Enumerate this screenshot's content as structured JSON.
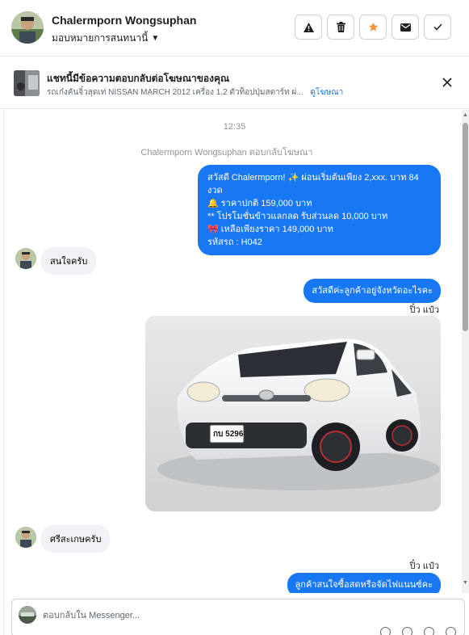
{
  "header": {
    "name": "Chalermporn Wongsuphan",
    "assign_label": "มอบหมายการสนทนานี้",
    "caret": "▼",
    "actions": [
      {
        "icon": "warning-icon"
      },
      {
        "icon": "trash-icon"
      },
      {
        "icon": "star-icon",
        "color": "#f7923b"
      },
      {
        "icon": "mail-icon"
      },
      {
        "icon": "check-icon"
      }
    ]
  },
  "ad": {
    "title": "แชทนี้มีข้อความตอบกลับต่อโฆษณาของคุณ",
    "subtitle": "รถเก๋งคันจิ๋วสุดเท่ NISSAN MARCH 2012 เครื่อง 1.2 ตัวท็อปปุ่มสตาร์ท ผ่...",
    "link": "ดูโฆษณา"
  },
  "chat": {
    "timestamp": "12:35",
    "system_line": "Chalermporn Wongsuphan ตอบกลับโฆษณา",
    "messages": [
      {
        "lines": [
          "สวัสดี Chalermporn! ✨  ผ่อนเริ่มต้นเพียง 2,xxx. บาท 84 งวด",
          "🔔 ราคาปกติ  159,000 บาท",
          "** โปรโมชั่นข้าวแลกลด รับส่วนลด 10,000 บาท",
          "🎀  เหลือเพียงราคา 149,000 บาท",
          " รหัสรถ : H042"
        ]
      },
      {
        "text": "สนใจครับ"
      },
      {
        "text": "สวัสดีค่ะลูกค้าอยู่จังหวัดอะไรคะ"
      },
      {
        "seen": "ปิ๋ว แป๋ว"
      },
      {
        "plate": "กบ 5296"
      },
      {
        "text": "ศรีสะเกษครับ"
      },
      {
        "seen": "ปิ๋ว แป๋ว"
      },
      {
        "text": "ลูกค้าสนใจซื้อสดหรือจัดไฟแนนซ์คะ"
      }
    ]
  },
  "composer": {
    "placeholder": "ตอบกลับใน Messenger..."
  },
  "colors": {
    "outgoing": "#1877f2",
    "incoming": "#f0f2f5",
    "link": "#1877f2",
    "star": "#f7923b"
  }
}
